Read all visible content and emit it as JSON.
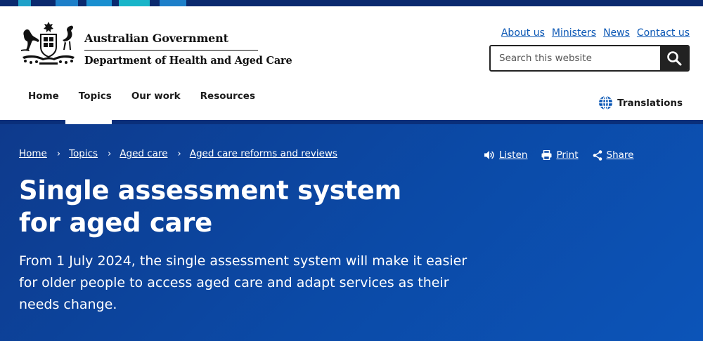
{
  "colors": {
    "strip": [
      "#0b2a6f",
      "#1fa1c9",
      "#0b2a6f",
      "#1d7fc9",
      "#0b2a6f",
      "#19b5c9",
      "#0b2a6f"
    ],
    "hero": "#0b4aa7",
    "link": "#0c58b5"
  },
  "brand": {
    "government": "Australian Government",
    "department": "Department of Health and Aged Care"
  },
  "utility_links": [
    "About us",
    "Ministers",
    "News",
    "Contact us"
  ],
  "search": {
    "placeholder": "Search this website"
  },
  "nav": {
    "items": [
      "Home",
      "Topics",
      "Our work",
      "Resources"
    ],
    "active": "Topics"
  },
  "translations_label": "Translations",
  "breadcrumb": [
    "Home",
    "Topics",
    "Aged care",
    "Aged care reforms and reviews"
  ],
  "page_tools": {
    "listen": "Listen",
    "print": "Print",
    "share": "Share"
  },
  "page_title": "Single assessment system for aged care",
  "lede": "From 1 July 2024, the single assessment system will make it easier for older people to access aged care and adapt services as their needs change."
}
